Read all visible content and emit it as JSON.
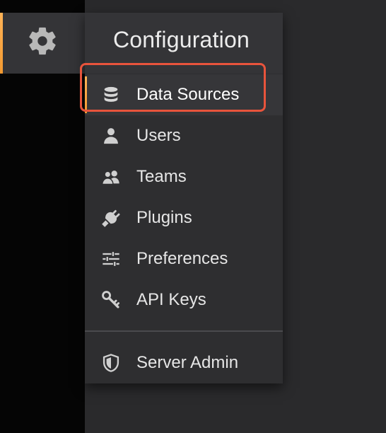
{
  "sidebar": {
    "active_icon": "gear-icon",
    "accent_color": "#f5a13c"
  },
  "menu": {
    "title": "Configuration",
    "items": [
      {
        "label": "Data Sources",
        "icon": "database-icon",
        "active": true
      },
      {
        "label": "Users",
        "icon": "user-icon",
        "active": false
      },
      {
        "label": "Teams",
        "icon": "users-icon",
        "active": false
      },
      {
        "label": "Plugins",
        "icon": "plug-icon",
        "active": false
      },
      {
        "label": "Preferences",
        "icon": "sliders-icon",
        "active": false
      },
      {
        "label": "API Keys",
        "icon": "key-icon",
        "active": false
      }
    ],
    "admin": {
      "label": "Server Admin",
      "icon": "shield-icon"
    }
  },
  "annotation": {
    "highlight_color": "#e8543c"
  }
}
